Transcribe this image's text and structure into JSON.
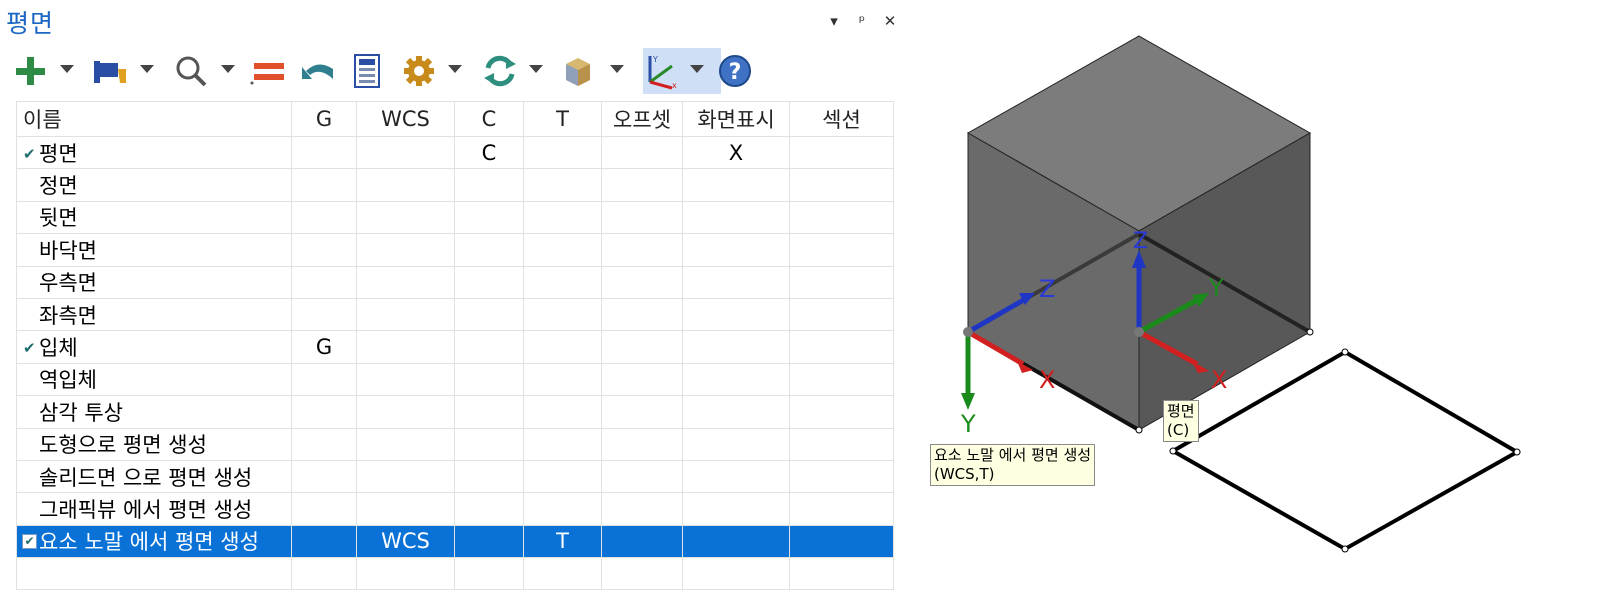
{
  "panel": {
    "title": "평면",
    "window_controls": [
      "▾",
      "ᵖ",
      "✕"
    ]
  },
  "toolbar": {
    "items": [
      "add-icon",
      "flag-icon",
      "search-icon",
      "equals-icon",
      "undo-icon",
      "calculator-icon",
      "gear-icon",
      "refresh-icon",
      "box-icon",
      "axis-icon",
      "help-icon"
    ]
  },
  "table": {
    "columns": [
      "이름",
      "G",
      "WCS",
      "C",
      "T",
      "오프셋",
      "화면표시",
      "섹션"
    ],
    "rows": [
      {
        "name": "평면",
        "g": "",
        "wcs": "",
        "c": "C",
        "t": "",
        "offset": "",
        "display": "X",
        "section": "",
        "checked": true,
        "selected": false
      },
      {
        "name": "정면",
        "g": "",
        "wcs": "",
        "c": "",
        "t": "",
        "offset": "",
        "display": "",
        "section": "",
        "checked": false,
        "selected": false
      },
      {
        "name": "뒷면",
        "g": "",
        "wcs": "",
        "c": "",
        "t": "",
        "offset": "",
        "display": "",
        "section": "",
        "checked": false,
        "selected": false
      },
      {
        "name": "바닥면",
        "g": "",
        "wcs": "",
        "c": "",
        "t": "",
        "offset": "",
        "display": "",
        "section": "",
        "checked": false,
        "selected": false
      },
      {
        "name": "우측면",
        "g": "",
        "wcs": "",
        "c": "",
        "t": "",
        "offset": "",
        "display": "",
        "section": "",
        "checked": false,
        "selected": false
      },
      {
        "name": "좌측면",
        "g": "",
        "wcs": "",
        "c": "",
        "t": "",
        "offset": "",
        "display": "",
        "section": "",
        "checked": false,
        "selected": false
      },
      {
        "name": "입체",
        "g": "G",
        "wcs": "",
        "c": "",
        "t": "",
        "offset": "",
        "display": "",
        "section": "",
        "checked": true,
        "selected": false
      },
      {
        "name": "역입체",
        "g": "",
        "wcs": "",
        "c": "",
        "t": "",
        "offset": "",
        "display": "",
        "section": "",
        "checked": false,
        "selected": false
      },
      {
        "name": "삼각 투상",
        "g": "",
        "wcs": "",
        "c": "",
        "t": "",
        "offset": "",
        "display": "",
        "section": "",
        "checked": false,
        "selected": false
      },
      {
        "name": "도형으로 평면 생성",
        "g": "",
        "wcs": "",
        "c": "",
        "t": "",
        "offset": "",
        "display": "",
        "section": "",
        "checked": false,
        "selected": false
      },
      {
        "name": "솔리드면 으로 평면 생성",
        "g": "",
        "wcs": "",
        "c": "",
        "t": "",
        "offset": "",
        "display": "",
        "section": "",
        "checked": false,
        "selected": false
      },
      {
        "name": "그래픽뷰 에서 평면 생성",
        "g": "",
        "wcs": "",
        "c": "",
        "t": "",
        "offset": "",
        "display": "",
        "section": "",
        "checked": false,
        "selected": false
      },
      {
        "name": "요소 노말 에서 평면 생성",
        "g": "",
        "wcs": "WCS",
        "c": "",
        "t": "T",
        "offset": "",
        "display": "",
        "section": "",
        "checked": true,
        "selected": true
      },
      {
        "name": "",
        "g": "",
        "wcs": "",
        "c": "",
        "t": "",
        "offset": "",
        "display": "",
        "section": "",
        "checked": false,
        "selected": false
      }
    ]
  },
  "viewport": {
    "axis_labels_left": {
      "x": "X",
      "y": "Y",
      "z": "Z"
    },
    "axis_labels_center": {
      "x": "X",
      "y": "Y",
      "z": "Z"
    },
    "plane_tag": {
      "line1": "평면",
      "line2": "(C)"
    },
    "element_tag": {
      "line1": "요소 노말 에서 평면 생성",
      "line2": "(WCS,T)"
    },
    "colors": {
      "x_axis": "#d21f1f",
      "y_axis": "#1a8a1a",
      "z_axis": "#1f35c4",
      "selection": "#0a72d6",
      "title": "#1a66c2"
    }
  }
}
